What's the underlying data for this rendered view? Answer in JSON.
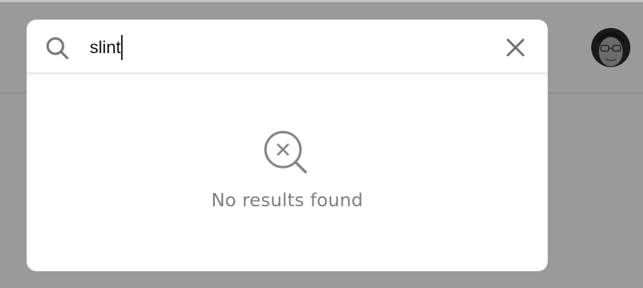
{
  "search": {
    "value": "slint",
    "icon": "search-icon",
    "clear_icon": "close-icon"
  },
  "empty_state": {
    "icon": "search-no-results-icon",
    "message": "No results found"
  },
  "user": {
    "avatar_icon": "avatar"
  },
  "colors": {
    "overlay": "#9a9a9a",
    "modal_bg": "#ffffff",
    "icon_gray": "#7a7a7a",
    "text_gray": "#808080",
    "input_text": "#111111"
  }
}
